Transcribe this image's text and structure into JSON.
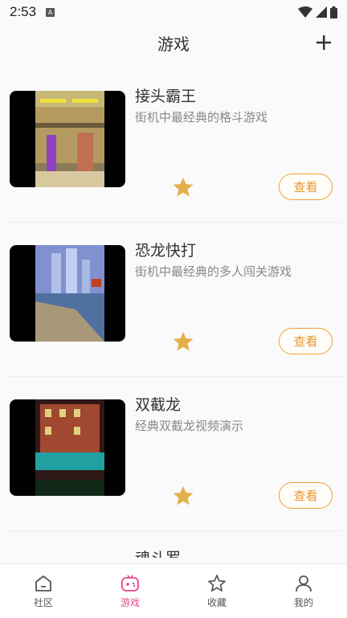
{
  "status_bar": {
    "time": "2:53",
    "notification_letter": "A"
  },
  "header": {
    "title": "游戏",
    "add_icon": "plus-icon"
  },
  "games": [
    {
      "title": "接头霸王",
      "desc": "街机中最经典的格斗游戏",
      "favorited": true,
      "button": "查看"
    },
    {
      "title": "恐龙快打",
      "desc": "街机中最经典的多人闯关游戏",
      "favorited": true,
      "button": "查看"
    },
    {
      "title": "双截龙",
      "desc": "经典双截龙视频演示",
      "favorited": true,
      "button": "查看"
    }
  ],
  "peek_item_title": "魂斗罗",
  "tabs": [
    {
      "label": "社区",
      "icon": "home-icon",
      "active": false
    },
    {
      "label": "游戏",
      "icon": "gamepad-icon",
      "active": true
    },
    {
      "label": "收藏",
      "icon": "star-outline-icon",
      "active": false
    },
    {
      "label": "我的",
      "icon": "user-icon",
      "active": false
    }
  ],
  "colors": {
    "accent": "#e8488a",
    "button_border": "#f0a030",
    "star": "#e2b04a"
  }
}
